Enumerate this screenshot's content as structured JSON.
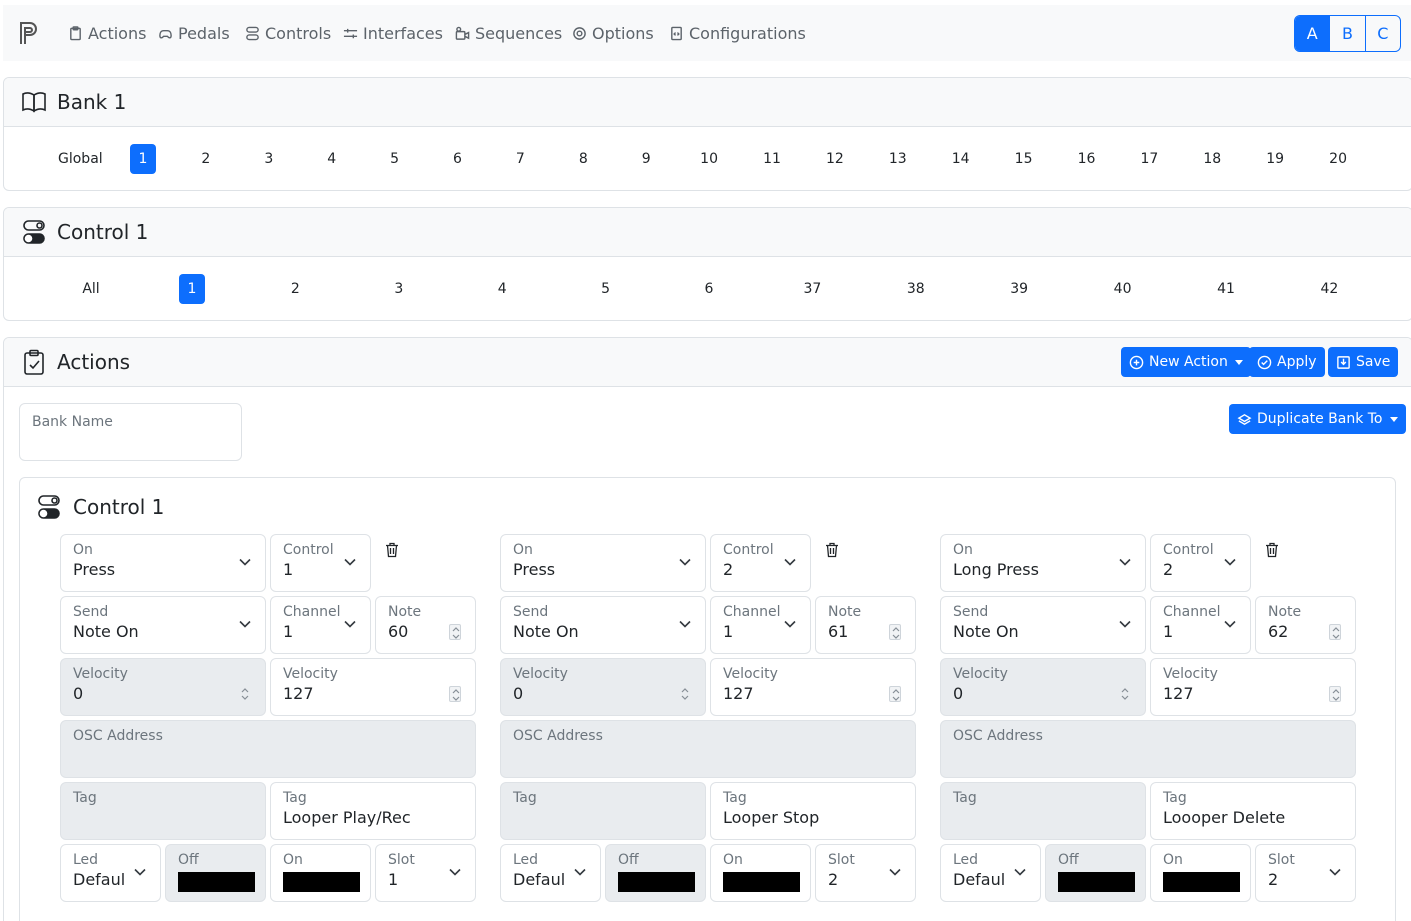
{
  "nav": {
    "items": [
      {
        "label": "Actions",
        "icon": "clipboard-icon"
      },
      {
        "label": "Pedals",
        "icon": "gamepad-icon"
      },
      {
        "label": "Controls",
        "icon": "toggles-icon"
      },
      {
        "label": "Interfaces",
        "icon": "interfaces-icon"
      },
      {
        "label": "Sequences",
        "icon": "sequences-icon"
      },
      {
        "label": "Options",
        "icon": "gear-icon"
      },
      {
        "label": "Configurations",
        "icon": "file-code-icon"
      }
    ],
    "profiles": [
      "A",
      "B",
      "C"
    ],
    "active_profile": "A"
  },
  "bank_card": {
    "title": "Bank 1",
    "global_label": "Global",
    "banks": [
      "1",
      "2",
      "3",
      "4",
      "5",
      "6",
      "7",
      "8",
      "9",
      "10",
      "11",
      "12",
      "13",
      "14",
      "15",
      "16",
      "17",
      "18",
      "19",
      "20"
    ],
    "active": "1"
  },
  "control_card": {
    "title": "Control 1",
    "all_label": "All",
    "controls": [
      "1",
      "2",
      "3",
      "4",
      "5",
      "6",
      "37",
      "38",
      "39",
      "40",
      "41",
      "42"
    ],
    "active": "1"
  },
  "actions_card": {
    "title": "Actions",
    "new_action_label": "New Action",
    "apply_label": "Apply",
    "save_label": "Save",
    "bank_name_label": "Bank Name",
    "bank_name_value": "",
    "duplicate_label": "Duplicate Bank To",
    "control_title": "Control 1",
    "actions": [
      {
        "on_label": "On",
        "on_value": "Press",
        "control_label": "Control",
        "control_value": "1",
        "send_label": "Send",
        "send_value": "Note On",
        "channel_label": "Channel",
        "channel_value": "1",
        "note_label": "Note",
        "note_value": "60",
        "vel_off_label": "Velocity",
        "vel_off_value": "0",
        "vel_on_label": "Velocity",
        "vel_on_value": "127",
        "osc_label": "OSC Address",
        "tag_off_label": "Tag",
        "tag_on_label": "Tag",
        "tag_on_value": "Looper Play/Rec",
        "led_label": "Led",
        "led_value": "Default",
        "off_label": "Off",
        "on_color_label": "On",
        "off_color": "#000000",
        "on_color": "#000000",
        "slot_label": "Slot",
        "slot_value": "1"
      },
      {
        "on_label": "On",
        "on_value": "Press",
        "control_label": "Control",
        "control_value": "2",
        "send_label": "Send",
        "send_value": "Note On",
        "channel_label": "Channel",
        "channel_value": "1",
        "note_label": "Note",
        "note_value": "61",
        "vel_off_label": "Velocity",
        "vel_off_value": "0",
        "vel_on_label": "Velocity",
        "vel_on_value": "127",
        "osc_label": "OSC Address",
        "tag_off_label": "Tag",
        "tag_on_label": "Tag",
        "tag_on_value": "Looper Stop",
        "led_label": "Led",
        "led_value": "Default",
        "off_label": "Off",
        "on_color_label": "On",
        "off_color": "#000000",
        "on_color": "#000000",
        "slot_label": "Slot",
        "slot_value": "2"
      },
      {
        "on_label": "On",
        "on_value": "Long Press",
        "control_label": "Control",
        "control_value": "2",
        "send_label": "Send",
        "send_value": "Note On",
        "channel_label": "Channel",
        "channel_value": "1",
        "note_label": "Note",
        "note_value": "62",
        "vel_off_label": "Velocity",
        "vel_off_value": "0",
        "vel_on_label": "Velocity",
        "vel_on_value": "127",
        "osc_label": "OSC Address",
        "tag_off_label": "Tag",
        "tag_on_label": "Tag",
        "tag_on_value": "Loooper Delete",
        "led_label": "Led",
        "led_value": "Default",
        "off_label": "Off",
        "on_color_label": "On",
        "off_color": "#000000",
        "on_color": "#000000",
        "slot_label": "Slot",
        "slot_value": "2"
      }
    ]
  },
  "colors": {
    "primary": "#0d6efd",
    "navbar_bg": "#f8f9fa",
    "disabled_bg": "#e9ecef",
    "border": "#dee2e6"
  }
}
